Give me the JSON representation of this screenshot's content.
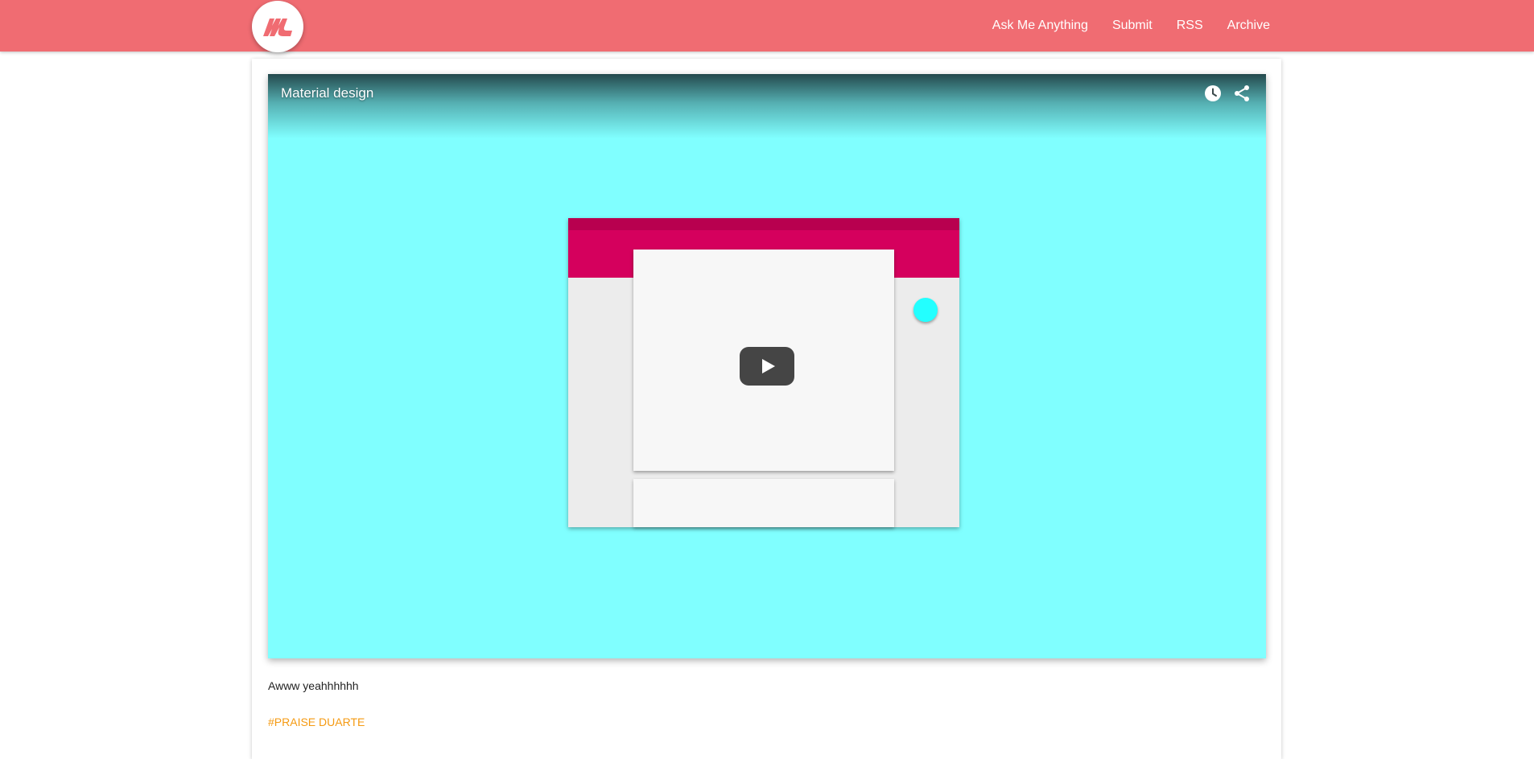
{
  "nav": {
    "items": [
      "Ask Me Anything",
      "Submit",
      "RSS",
      "Archive"
    ]
  },
  "post": {
    "video": {
      "title": "Material design",
      "icons": [
        "clock-icon",
        "share-icon",
        "play-icon"
      ]
    },
    "caption": "Awww yeahhhhhh",
    "tag": "#PRAISE DUARTE"
  },
  "colors": {
    "header": "#f06c72",
    "video_bg": "#80ffff",
    "thumb_accent": "#d5005d",
    "thumb_accent_dark": "#b8004f",
    "fab": "#23ffff",
    "tag": "#f59a12"
  }
}
